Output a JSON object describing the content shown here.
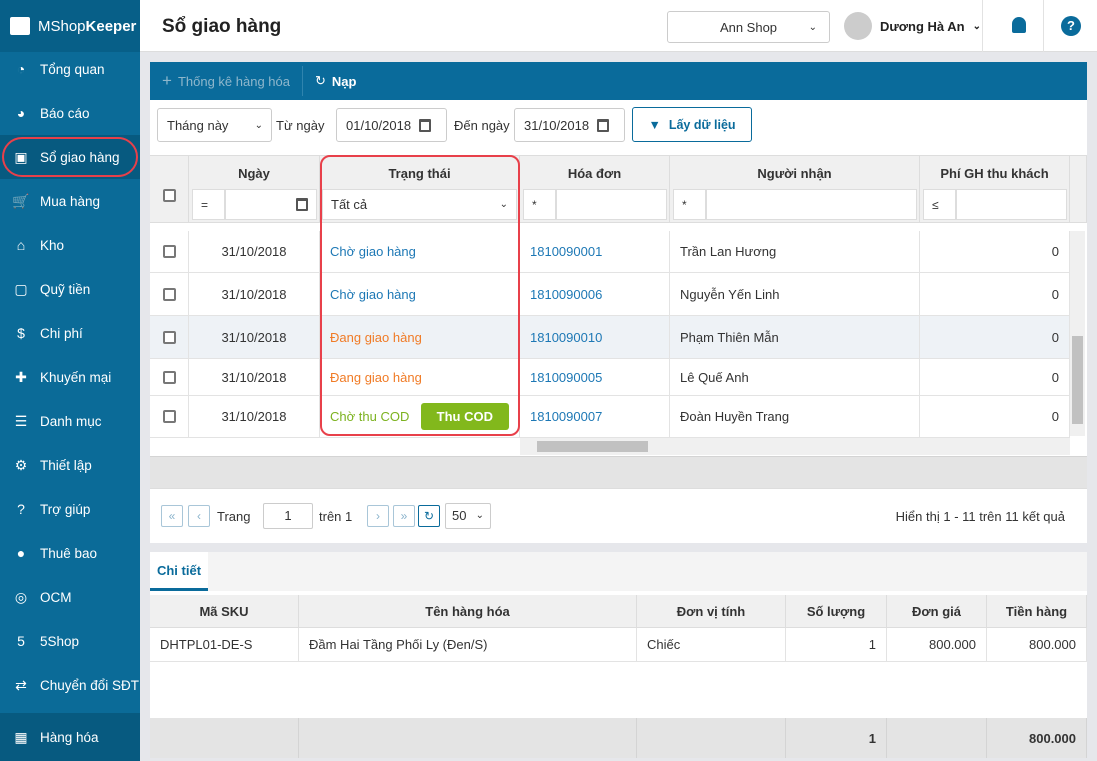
{
  "app": {
    "brand_light": "MShop",
    "brand_bold": "Keeper"
  },
  "sidebar": {
    "items": [
      {
        "label": "Tổng quan",
        "icon": "dashboard-icon"
      },
      {
        "label": "Báo cáo",
        "icon": "pie-chart-icon"
      },
      {
        "label": "Sổ giao hàng",
        "icon": "delivery-truck-icon",
        "active": true
      },
      {
        "label": "Mua hàng",
        "icon": "cart-icon"
      },
      {
        "label": "Kho",
        "icon": "warehouse-icon"
      },
      {
        "label": "Quỹ tiền",
        "icon": "safe-icon"
      },
      {
        "label": "Chi phí",
        "icon": "money-bag-icon"
      },
      {
        "label": "Khuyến mại",
        "icon": "gift-icon"
      },
      {
        "label": "Danh mục",
        "icon": "list-icon"
      },
      {
        "label": "Thiết lập",
        "icon": "gear-icon"
      },
      {
        "label": "Trợ giúp",
        "icon": "help-icon"
      },
      {
        "label": "Thuê bao",
        "icon": "user-icon"
      },
      {
        "label": "OCM",
        "icon": "ocm-icon"
      },
      {
        "label": "5Shop",
        "icon": "5shop-icon"
      },
      {
        "label": "Chuyển đổi SĐT",
        "icon": "phone-convert-icon"
      }
    ],
    "bottom": {
      "label": "Hàng hóa",
      "icon": "boxes-icon"
    }
  },
  "header": {
    "title": "Sổ giao hàng",
    "shop": "Ann Shop",
    "user": "Dương Hà An"
  },
  "toolbar": {
    "stats": "Thống kê hàng hóa",
    "reload": "Nạp"
  },
  "filters": {
    "period": "Tháng này",
    "from_label": "Từ ngày",
    "from": "01/10/2018",
    "to_label": "Đến ngày",
    "to": "31/10/2018",
    "get": "Lấy dữ liệu"
  },
  "grid": {
    "columns": [
      "Ngày",
      "Trạng thái",
      "Hóa đơn",
      "Người nhận",
      "Phí GH thu khách"
    ],
    "filter_ops": [
      "=",
      "*",
      "*",
      "≤"
    ],
    "status_filter": "Tất cả",
    "rows": [
      {
        "date": "31/10/2018",
        "status": "Chờ giao hàng",
        "status_type": "waiting",
        "invoice": "1810090001",
        "recipient": "Trần Lan Hương",
        "fee": "0"
      },
      {
        "date": "31/10/2018",
        "status": "Chờ giao hàng",
        "status_type": "waiting",
        "invoice": "1810090006",
        "recipient": "Nguyễn Yến Linh",
        "fee": "0"
      },
      {
        "date": "31/10/2018",
        "status": "Đang giao hàng",
        "status_type": "delivering",
        "invoice": "1810090010",
        "recipient": "Phạm Thiên Mẫn",
        "fee": "0"
      },
      {
        "date": "31/10/2018",
        "status": "Đang giao hàng",
        "status_type": "delivering",
        "invoice": "1810090005",
        "recipient": "Lê Quế Anh",
        "fee": "0"
      },
      {
        "date": "31/10/2018",
        "status": "Chờ thu COD",
        "status_type": "cod",
        "invoice": "1810090007",
        "recipient": "Đoàn Huyền Trang",
        "fee": "0",
        "action": "Thu COD"
      }
    ]
  },
  "pager": {
    "page_label": "Trang",
    "page": "1",
    "of": "trên 1",
    "size": "50",
    "summary": "Hiển thị 1 - 11 trên 11 kết quả"
  },
  "detail": {
    "tab": "Chi tiết",
    "columns": [
      "Mã SKU",
      "Tên hàng hóa",
      "Đơn vị tính",
      "Số lượng",
      "Đơn giá",
      "Tiền hàng"
    ],
    "row": [
      "DHTPL01-DE-S",
      "Đầm Hai Tầng Phối Ly (Đen/S)",
      "Chiếc",
      "1",
      "800.000",
      "800.000"
    ],
    "totals": {
      "qty": "1",
      "amount": "800.000"
    }
  },
  "colors": {
    "sidebar": "#0b6b98",
    "accent": "#0a6b9b",
    "waiting": "#1d78b5",
    "delivering": "#f07b26",
    "cod": "#7cb21f",
    "highlight": "#e8404a"
  }
}
